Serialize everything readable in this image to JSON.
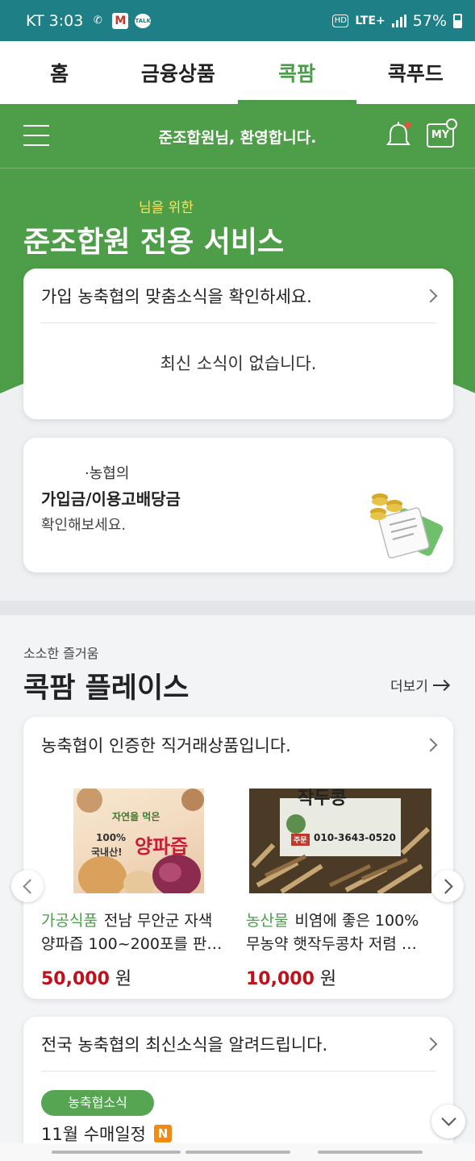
{
  "status_bar": {
    "carrier_time": "KT 3:03",
    "network": "LTE+",
    "battery": "57%"
  },
  "tabs": [
    {
      "label": "홈",
      "active": false
    },
    {
      "label": "금융상품",
      "active": false
    },
    {
      "label": "콕팜",
      "active": true
    },
    {
      "label": "콕푸드",
      "active": false
    }
  ],
  "header": {
    "welcome": "준조합원님, 환영합니다.",
    "my_label": "MY"
  },
  "hero": {
    "subtitle": "님을 위한",
    "title": "준조합원 전용 서비스"
  },
  "news_card": {
    "title": "가입 농축협의 맞춤소식을 확인하세요.",
    "empty_message": "최신 소식이 없습니다."
  },
  "dividend_card": {
    "line1": "·농협의",
    "line2": "가입금/이용고배당금",
    "line3": "확인해보세요."
  },
  "place_section": {
    "subtitle": "소소한 즐거움",
    "title": "콕팜 플레이스",
    "more_label": "더보기"
  },
  "direct_card": {
    "title": "농축협이 인증한 직거래상품입니다.",
    "products": [
      {
        "category": "가공식품",
        "name": "전남 무안군 자색 양파즙 100~200포를 판…",
        "price": "50,000",
        "unit": "원",
        "image_text": [
          "자연을 먹은",
          "100%",
          "국내산!",
          "양파즙"
        ]
      },
      {
        "category": "농산물",
        "name": "비염에 좋은 100% 무농약 햇작두콩차 저렴 …",
        "price": "10,000",
        "unit": "원",
        "image_text": [
          "작두콩",
          "주문",
          "010-3643-0520"
        ]
      }
    ]
  },
  "latest_card": {
    "title": "전국 농축협의 최신소식을 알려드립니다.",
    "tag": "농축협소식",
    "item": "11월 수매일정",
    "badge": "N"
  },
  "colors": {
    "brand_green": "#4e9d48",
    "status_teal": "#1f7f86",
    "price_red": "#c0101b",
    "highlight_yellow": "#ffe45a",
    "new_badge_orange": "#f08a13"
  }
}
